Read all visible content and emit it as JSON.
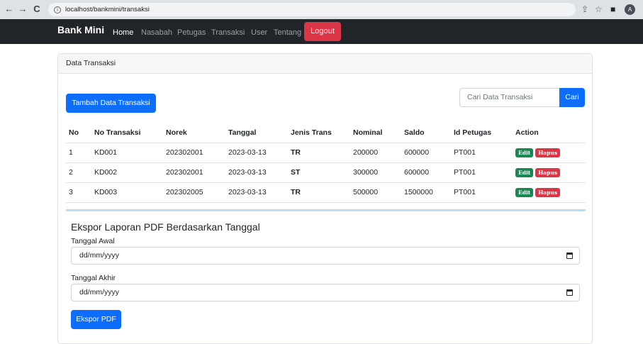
{
  "browser": {
    "url": "localhost/bankmini/transaksi",
    "back_glyph": "←",
    "forward_glyph": "→",
    "reload_glyph": "C",
    "info_glyph": "i",
    "share_glyph": "⇪",
    "star_glyph": "☆",
    "panel_glyph": "■",
    "avatar_letter": "A"
  },
  "navbar": {
    "brand": "Bank Mini",
    "links": [
      "Home",
      "Nasabah",
      "Petugas",
      "Transaksi",
      "User",
      "Tentang"
    ],
    "logout": "Logout"
  },
  "card": {
    "header": "Data Transaksi",
    "add_button": "Tambah Data Transaksi",
    "search_placeholder": "Cari Data Transaksi",
    "search_button": "Cari"
  },
  "table": {
    "headers": [
      "No",
      "No Transaksi",
      "Norek",
      "Tanggal",
      "Jenis Trans",
      "Nominal",
      "Saldo",
      "Id Petugas",
      "Action"
    ],
    "rows": [
      [
        "1",
        "KD001",
        "202302001",
        "2023-03-13",
        "TR",
        "200000",
        "600000",
        "PT001"
      ],
      [
        "2",
        "KD002",
        "202302001",
        "2023-03-13",
        "ST",
        "300000",
        "600000",
        "PT001"
      ],
      [
        "3",
        "KD003",
        "202302005",
        "2023-03-13",
        "TR",
        "500000",
        "1500000",
        "PT001"
      ]
    ],
    "edit_label": "Edit",
    "delete_label": "Hapus"
  },
  "export": {
    "title": "Ekspor Laporan PDF Berdasarkan Tanggal",
    "start_label": "Tanggal Awal",
    "start_placeholder": "dd/mm/yyyy",
    "end_label": "Tanggal Akhir",
    "end_placeholder": "dd/mm/yyyy",
    "button": "Ekspor PDF"
  },
  "colors": {
    "primary": "#0d6efd",
    "danger": "#dc3545",
    "success": "#198754",
    "navbar": "#212529"
  }
}
